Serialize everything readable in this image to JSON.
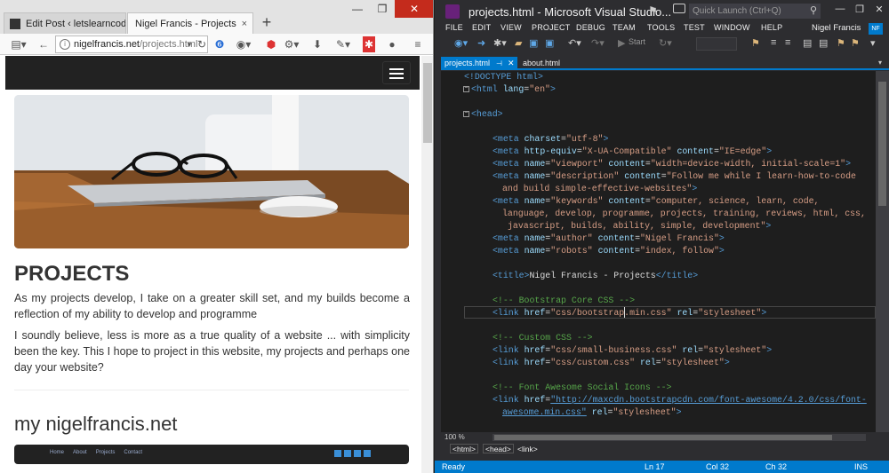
{
  "browser": {
    "tabs": [
      {
        "label": "Edit Post ‹ letslearncode ...",
        "close": "×"
      },
      {
        "label": "Nigel Francis - Projects",
        "close": "×"
      }
    ],
    "new_tab": "+",
    "url_host": "nigelfrancis.net",
    "url_path": "/projects.html",
    "site": {
      "heading": "PROJECTS",
      "para1": "As my projects develop, I take on a greater skill set, and my builds become a reflection of my ability to develop and programme",
      "para2": "I soundly believe, less is more as a true quality of a website ... with simplicity been the key. This I hope to project in this website, my projects and perhaps one day your website?",
      "heading2": "my nigelfrancis.net",
      "mini_nav": [
        "Home",
        "About",
        "Projects",
        "Contact"
      ]
    }
  },
  "vs": {
    "title": "projects.html - Microsoft Visual Studio...",
    "quick_launch": "Quick Launch (Ctrl+Q)",
    "menu": [
      "FILE",
      "EDIT",
      "VIEW",
      "PROJECT",
      "DEBUG",
      "TEAM",
      "TOOLS",
      "TEST",
      "WINDOW",
      "HELP"
    ],
    "user": "Nigel Francis",
    "user_initials": "NF",
    "start_label": "Start",
    "tabs": [
      "projects.html",
      "about.html"
    ],
    "zoom": "100 %",
    "breadcrumb": [
      "<html>",
      "<head>",
      "<link>"
    ],
    "status": {
      "ready": "Ready",
      "ln": "Ln 17",
      "col": "Col 32",
      "ch": "Ch 32",
      "ins": "INS"
    },
    "code": {
      "l1": "<!DOCTYPE html>",
      "l2_tag": "<html ",
      "l2_attr": "lang",
      "l2_val": "\"en\"",
      "l4": "<head>",
      "charset": "\"utf-8\"",
      "http_equiv": "\"X-UA-Compatible\"",
      "ie_edge": "\"IE=edge\"",
      "viewport": "\"viewport\"",
      "viewport_val": "\"width=device-width, initial-scale=1\"",
      "description": "\"description\"",
      "desc_val_1": "\"Follow me while I learn-how-to-code",
      "desc_val_2": "and build simple-effective-websites\"",
      "keywords": "\"keywords\"",
      "kw_1": "\"computer, science, learn, code,",
      "kw_2": "language, develop, programme, projects, training, reviews, html, css,",
      "kw_3": "javascript, builds, ability, simple, development\"",
      "author": "\"author\"",
      "author_val": "\"Nigel Francis\"",
      "robots": "\"robots\"",
      "robots_val": "\"index, follow\"",
      "title_text": "Nigel Francis - Projects",
      "comment1": "<!-- Bootstrap Core CSS -->",
      "href1": "\"css/bootstrap.min.css\"",
      "comment2": "<!-- Custom CSS -->",
      "href2": "\"css/small-business.css\"",
      "href3": "\"css/custom.css\"",
      "comment3": "<!-- Font Awesome Social Icons -->",
      "href4": "\"http://maxcdn.bootstrapcdn.com/font-awesome/4.2.0/css/font-",
      "href4b": "awesome.min.css\"",
      "stylesheet": "\"stylesheet\""
    }
  }
}
